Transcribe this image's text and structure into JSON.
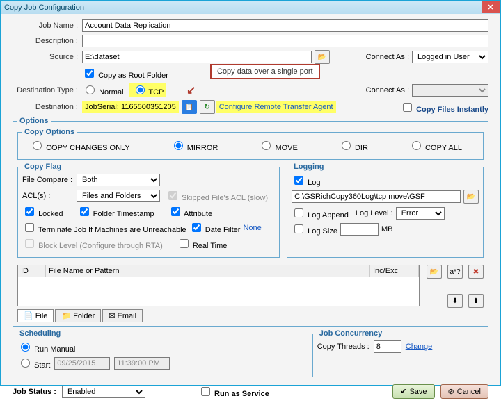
{
  "window": {
    "title": "Copy Job Configuration"
  },
  "labels": {
    "jobName": "Job Name :",
    "description": "Description :",
    "source": "Source :",
    "connectAs1": "Connect As :",
    "copyAsRoot": "Copy as Root Folder",
    "destType": "Destination Type :",
    "normal": "Normal",
    "tcp": "TCP",
    "connectAs2": "Connect As :",
    "destination": "Destination :",
    "jobSerialLabel": "JobSerial:",
    "configRTA": "Configure Remote Transfer Agent",
    "copyFilesInstantly": "Copy Files Instantly",
    "options": "Options",
    "copyOptions": "Copy Options",
    "copyChanges": "COPY CHANGES ONLY",
    "mirror": "MIRROR",
    "move": "MOVE",
    "dir": "DIR",
    "copyAll": "COPY ALL",
    "copyFlag": "Copy Flag",
    "fileCompare": "File Compare :",
    "acls": "ACL(s) :",
    "skippedACL": "Skipped File's ACL (slow)",
    "locked": "Locked",
    "folderTs": "Folder Timestamp",
    "attribute": "Attribute",
    "terminate": "Terminate Job If Machines are Unreachable",
    "dateFilter": "Date Filter",
    "dateFilterNone": "None",
    "blockLevel": "Block Level (Configure through RTA)",
    "realTime": "Real Time",
    "logging": "Logging",
    "log": "Log",
    "logAppend": "Log Append",
    "logLevel": "Log Level :",
    "logSize": "Log Size",
    "mb": "MB",
    "colId": "ID",
    "colFile": "File Name or Pattern",
    "colIncExc": "Inc/Exc",
    "tabFile": "File",
    "tabFolder": "Folder",
    "tabEmail": "Email",
    "scheduling": "Scheduling",
    "runManual": "Run Manual",
    "start": "Start",
    "jobConcurrency": "Job Concurrency",
    "copyThreads": "Copy Threads :",
    "change": "Change",
    "jobStatus": "Job Status :",
    "runAsService": "Run as Service",
    "save": "Save",
    "cancel": "Cancel",
    "callout": "Copy data over a single port"
  },
  "values": {
    "jobName": "Account Data Replication",
    "description": "",
    "source": "E:\\dataset",
    "connectAs1": "Logged in User",
    "jobSerial": "1165500351205",
    "fileCompare": "Both",
    "acls": "Files and Folders",
    "logPath": "C:\\GSRichCopy360Log\\tcp move\\GSF",
    "logLevel": "Error",
    "logSize": "",
    "schedDate": "09/25/2015",
    "schedTime": "11:39:00 PM",
    "copyThreads": "8",
    "jobStatus": "Enabled"
  },
  "colors": {
    "accent": "#1ba3d6",
    "highlight": "#ffff66",
    "callout": "#b03a2e"
  }
}
